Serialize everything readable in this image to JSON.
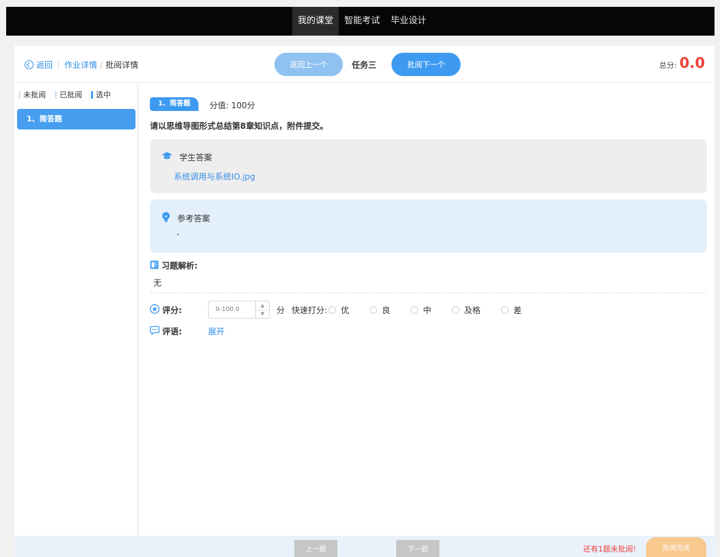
{
  "topnav": {
    "items": [
      {
        "label": "我的课堂",
        "active": true
      },
      {
        "label": "智能考试",
        "active": false
      },
      {
        "label": "毕业设计",
        "active": false
      }
    ]
  },
  "header": {
    "back_label": "返回",
    "breadcrumb_parent": "作业详情",
    "breadcrumb_sep": "/",
    "breadcrumb_current": "批阅详情",
    "prev_student_label": "返回上一个",
    "task_name": "任务三",
    "next_student_label": "批阅下一个",
    "total_label": "总分:",
    "total_value": "0.0"
  },
  "sidebar": {
    "legend": [
      {
        "label": "未批阅",
        "color": "#e6e6e6"
      },
      {
        "label": "已批阅",
        "color": "#cfe3f8"
      },
      {
        "label": "选中",
        "color": "#479ef0"
      }
    ],
    "questions": [
      {
        "label": "1、简答题",
        "selected": true
      }
    ]
  },
  "question": {
    "tag": "1、简答题",
    "score_text": "分值: 100分",
    "text": "请以思维导图形式总结第8章知识点，附件提交。",
    "student_answer_title": "学生答案",
    "student_file": "系统调用与系统IO.jpg",
    "reference_title": "参考答案",
    "reference_content": ".",
    "analysis_title": "习题解析:",
    "analysis_body": "无"
  },
  "grading": {
    "score_label": "评分:",
    "score_placeholder": "0-100.0",
    "unit": "分",
    "quick_label": "快速打分:",
    "quick_options": [
      "优",
      "良",
      "中",
      "及格",
      "差"
    ],
    "comment_label": "评语:",
    "expand_label": "展开"
  },
  "footer": {
    "prev_question_label": "上一题",
    "next_question_label": "下一题",
    "remaining_text": "还有1题未批阅!",
    "finish_label": "批阅完成"
  },
  "colors": {
    "accent": "#3d9af0",
    "danger": "#f0423a",
    "finish": "#f7c98e",
    "topbar": "#070707"
  }
}
